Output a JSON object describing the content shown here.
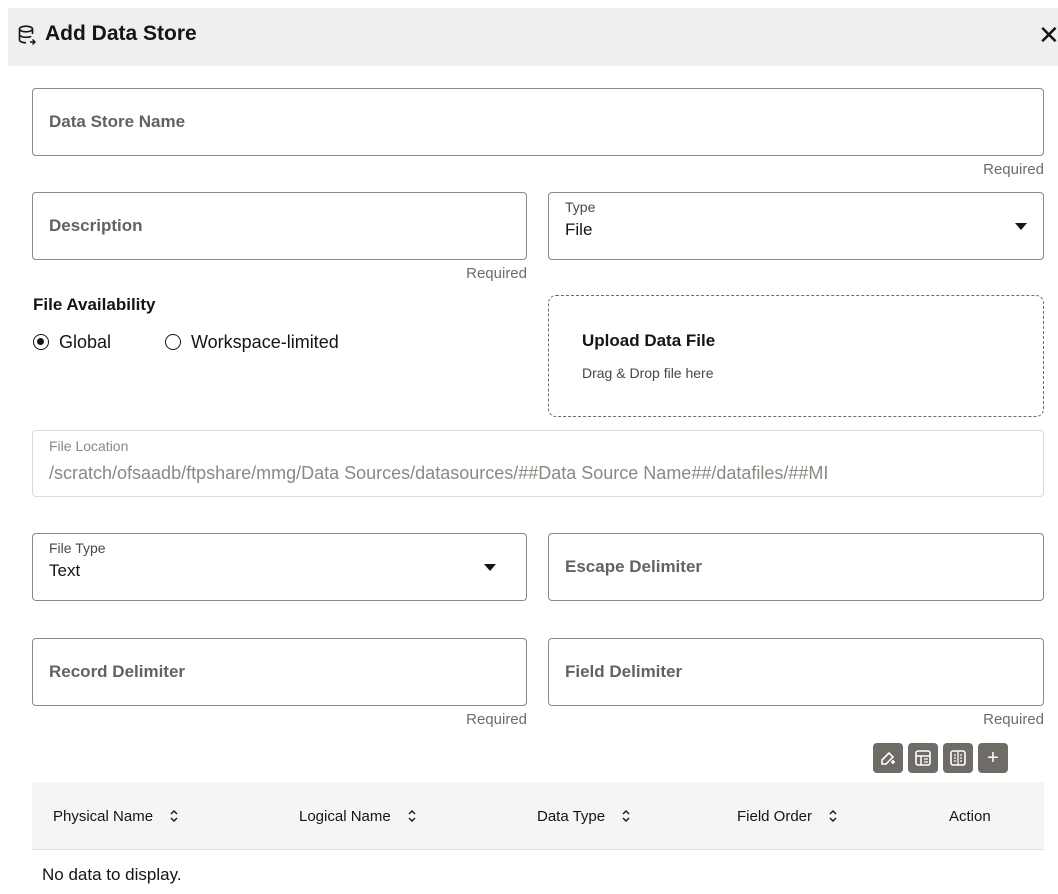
{
  "dialog": {
    "title": "Add Data Store",
    "close_label": "✕"
  },
  "form": {
    "data_store_name": {
      "placeholder": "Data Store Name",
      "required": "Required"
    },
    "description": {
      "placeholder": "Description",
      "required": "Required"
    },
    "type": {
      "label": "Type",
      "value": "File"
    },
    "file_availability": {
      "title": "File Availability",
      "options": [
        {
          "label": "Global",
          "checked": true
        },
        {
          "label": "Workspace-limited",
          "checked": false
        }
      ]
    },
    "upload": {
      "title": "Upload Data File",
      "subtitle": "Drag & Drop file here"
    },
    "file_location": {
      "label": "File Location",
      "value": "/scratch/ofsaadb/ftpshare/mmg/Data Sources/datasources/##Data Source Name##/datafiles/##MI"
    },
    "file_type": {
      "label": "File Type",
      "value": "Text"
    },
    "escape_delimiter": {
      "placeholder": "Escape Delimiter"
    },
    "record_delimiter": {
      "placeholder": "Record Delimiter",
      "required": "Required"
    },
    "field_delimiter": {
      "placeholder": "Field Delimiter",
      "required": "Required"
    }
  },
  "toolbar": {
    "buttons": [
      {
        "icon": "edit-icon"
      },
      {
        "icon": "database-icon"
      },
      {
        "icon": "grid-icon"
      },
      {
        "icon": "plus-icon",
        "glyph": "+"
      }
    ]
  },
  "table": {
    "columns": [
      "Physical Name",
      "Logical Name",
      "Data Type",
      "Field Order",
      "Action"
    ],
    "empty_text": "No data to display."
  },
  "colors": {
    "header_bg": "#f1efed",
    "button_bg": "#6f6c68",
    "border": "#8c8883"
  }
}
